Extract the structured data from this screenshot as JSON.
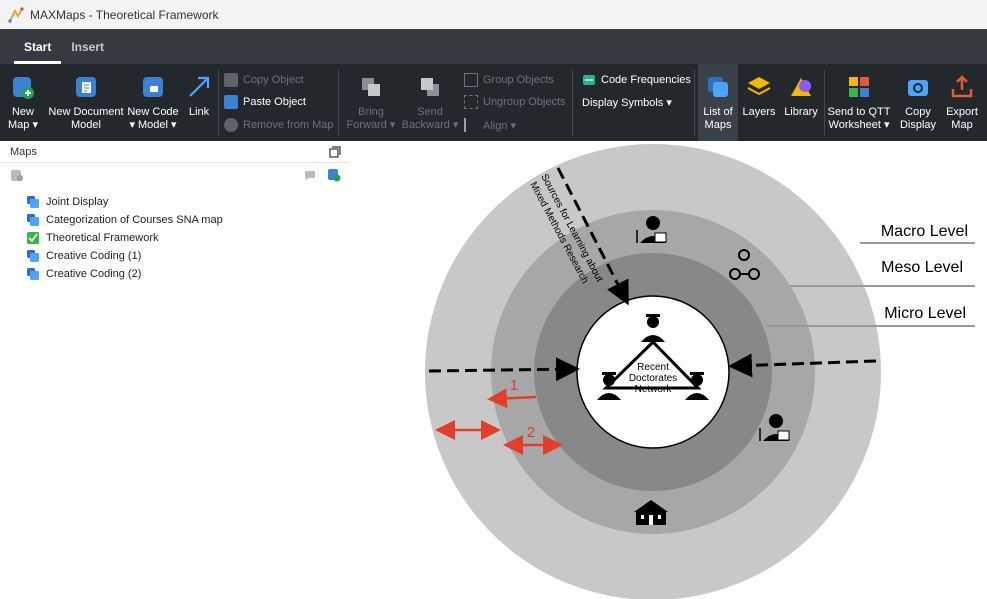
{
  "window": {
    "title": "MAXMaps - Theoretical Framework"
  },
  "tabs": [
    {
      "label": "Start",
      "active": true
    },
    {
      "label": "Insert",
      "active": false
    }
  ],
  "ribbon": {
    "new_map": {
      "line1": "New",
      "line2": "Map ▾"
    },
    "new_document_model": {
      "line1": "New Document",
      "line2": "Model"
    },
    "new_code_model": {
      "line1": "New Code",
      "line2": "▾ Model ▾"
    },
    "link": {
      "label": "Link"
    },
    "copy_object": "Copy Object",
    "paste_object": "Paste Object",
    "remove_from_map": "Remove from Map",
    "bring_forward": {
      "line1": "Bring",
      "line2": "Forward ▾"
    },
    "send_backward": {
      "line1": "Send",
      "line2": "Backward ▾"
    },
    "group_objects": "Group Objects",
    "ungroup_objects": "Ungroup Objects",
    "align": "Align ▾",
    "code_frequencies": "Code Frequencies",
    "display_symbols": "Display Symbols ▾",
    "list_of_maps": {
      "line1": "List of",
      "line2": "Maps"
    },
    "layers": {
      "label": "Layers"
    },
    "library": {
      "label": "Library"
    },
    "send_to_qtt": {
      "line1": "Send to QTT",
      "line2": "Worksheet ▾"
    },
    "copy_display": {
      "line1": "Copy",
      "line2": "Display"
    },
    "export_map": {
      "line1": "Export",
      "line2": "Map"
    }
  },
  "maps_panel": {
    "title": "Maps",
    "items": [
      {
        "label": "Joint Display",
        "icon": "map-icon"
      },
      {
        "label": "Categorization of Courses SNA map",
        "icon": "map-icon"
      },
      {
        "label": "Theoretical Framework",
        "icon": "active-map-icon"
      },
      {
        "label": "Creative Coding (1)",
        "icon": "map-icon"
      },
      {
        "label": "Creative Coding (2)",
        "icon": "map-icon"
      }
    ]
  },
  "diagram": {
    "levels": {
      "macro": "Macro Level",
      "meso": "Meso Level",
      "micro": "Micro Level"
    },
    "network_line1": "Recent",
    "network_line2": "Doctorates",
    "network_line3": "Network",
    "sources_line1": "Sources for Learning about",
    "sources_line2": "Mixed Methods Research",
    "arrow1": "1",
    "arrow2": "2",
    "colors": {
      "outer": "#c8c8c8",
      "middle": "#a7a7a7",
      "inner": "#888888",
      "red_arrow": "#e0402a"
    }
  }
}
